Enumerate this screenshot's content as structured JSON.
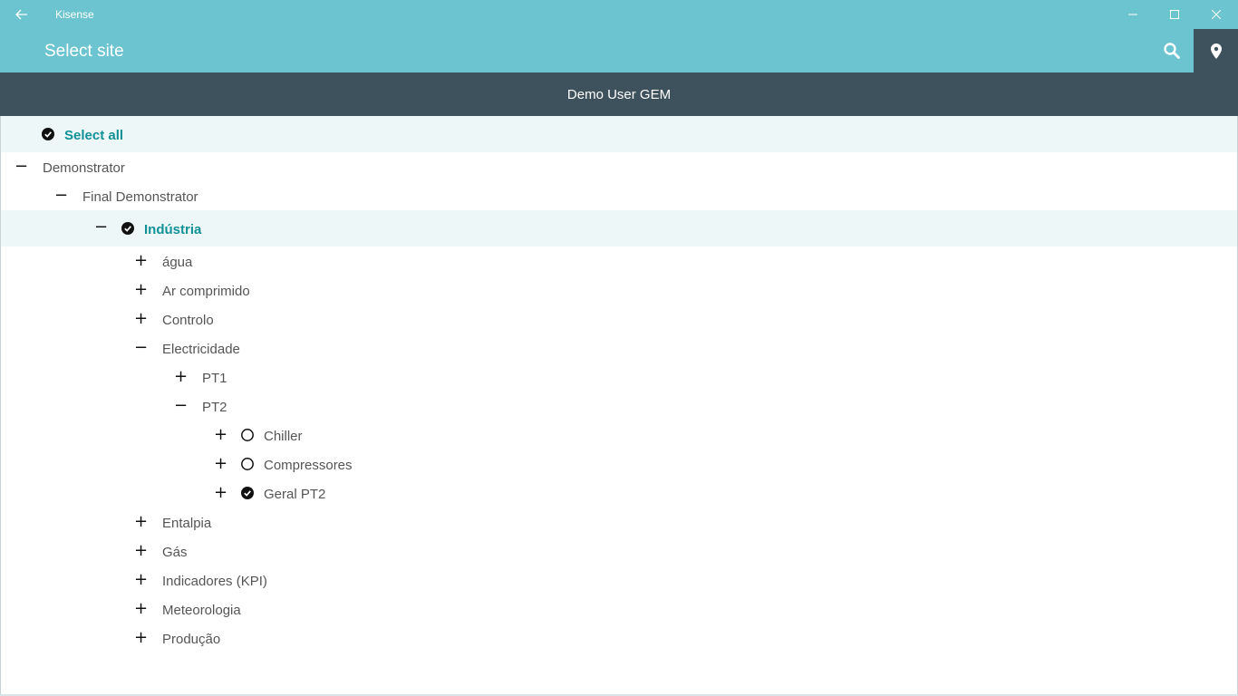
{
  "window": {
    "app_title": "Kisense",
    "back_icon": "arrow-left-icon",
    "minimize_icon": "minimize-icon",
    "maximize_icon": "maximize-icon",
    "close_icon": "close-icon"
  },
  "header": {
    "title": "Select site",
    "search_icon": "search-icon",
    "location_icon": "map-pin-icon"
  },
  "user": {
    "name": "Demo User GEM"
  },
  "colors": {
    "accent": "#6bc4cf",
    "dark_bar": "#3e525d",
    "selected_text": "#0f9196",
    "selected_bg": "#eef7f8"
  },
  "tree": {
    "select_all": {
      "label": "Select all",
      "checked": true
    },
    "nodes": [
      {
        "label": "Demonstrator",
        "expanded": true
      },
      {
        "label": "Final Demonstrator",
        "expanded": true
      },
      {
        "label": "Indústria",
        "expanded": true,
        "checked": true
      },
      {
        "label": "água",
        "expanded": false
      },
      {
        "label": "Ar comprimido",
        "expanded": false
      },
      {
        "label": "Controlo",
        "expanded": false
      },
      {
        "label": "Electricidade",
        "expanded": true
      },
      {
        "label": "PT1",
        "expanded": false
      },
      {
        "label": "PT2",
        "expanded": true
      },
      {
        "label": "Chiller",
        "expanded": false,
        "checked": false
      },
      {
        "label": "Compressores",
        "expanded": false,
        "checked": false
      },
      {
        "label": "Geral PT2",
        "expanded": false,
        "checked": true
      },
      {
        "label": "Entalpia",
        "expanded": false
      },
      {
        "label": "Gás",
        "expanded": false
      },
      {
        "label": "Indicadores (KPI)",
        "expanded": false
      },
      {
        "label": "Meteorologia",
        "expanded": false
      },
      {
        "label": "Produção",
        "expanded": false
      }
    ]
  }
}
